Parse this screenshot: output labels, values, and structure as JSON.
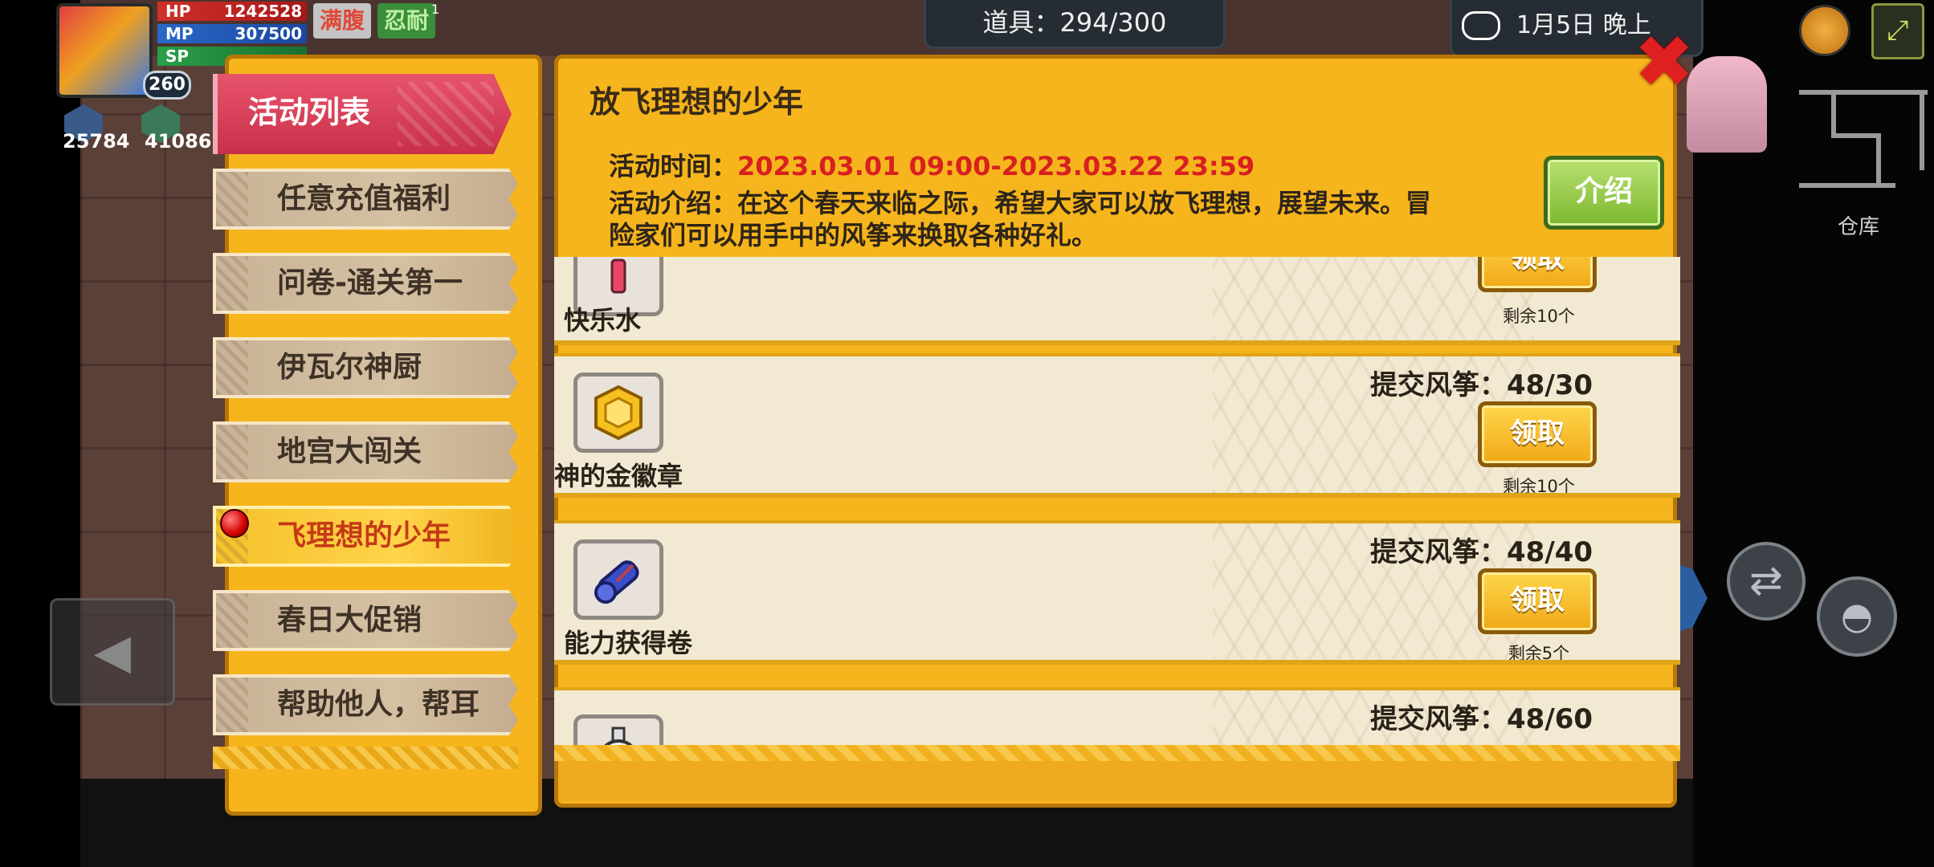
{
  "hud": {
    "level": "260",
    "hp_label": "HP",
    "hp_value": "1242528",
    "mp_label": "MP",
    "mp_value": "307500",
    "sp_label": "SP",
    "tag_full": "满腹",
    "tag_ninja": "忍耐",
    "tag_ninja_sup": "1",
    "gem1_value": "25784",
    "gem2_value": "41086",
    "items_counter": "道具：294/300",
    "date_text": "1月5日 晚上",
    "warehouse_label": "仓库"
  },
  "sidebar": {
    "header": "活动列表",
    "items": [
      {
        "label": "任意充值福利",
        "active": false
      },
      {
        "label": "问卷-通关第一",
        "active": false
      },
      {
        "label": "伊瓦尔神厨",
        "active": false
      },
      {
        "label": "地宫大闯关",
        "active": false
      },
      {
        "label": "飞理想的少年",
        "active": true
      },
      {
        "label": "春日大促销",
        "active": false
      },
      {
        "label": "帮助他人，帮耳",
        "active": false
      }
    ]
  },
  "event": {
    "title": "放飞理想的少年",
    "time_label": "活动时间：",
    "time_value": "2023.03.01 09:00-2023.03.22 23:59",
    "intro_line1": "活动介绍：在这个春天来临之际，希望大家可以放飞理想，展望未来。冒",
    "intro_line2": "险家们可以用手中的风筝来换取各种好礼。",
    "intro_button": "介绍"
  },
  "rewards": [
    {
      "name": "快乐水",
      "submit": "",
      "button": "领取",
      "remaining": "剩余10个",
      "icon": "potion-icon"
    },
    {
      "name": "神的金徽章",
      "submit": "提交风筝：48/30",
      "button": "领取",
      "remaining": "剩余10个",
      "icon": "gold-badge-icon"
    },
    {
      "name": "能力获得卷",
      "submit": "提交风筝：48/40",
      "button": "领取",
      "remaining": "剩余5个",
      "icon": "scroll-icon"
    },
    {
      "name": "",
      "submit": "提交风筝：48/60",
      "button": "",
      "remaining": "",
      "icon": "flask-icon"
    }
  ],
  "colors": {
    "panel": "#f6b51c",
    "panel_border": "#b87708",
    "header_red": "#d83c56",
    "time_red": "#d82020",
    "intro_green": "#7cb830"
  }
}
